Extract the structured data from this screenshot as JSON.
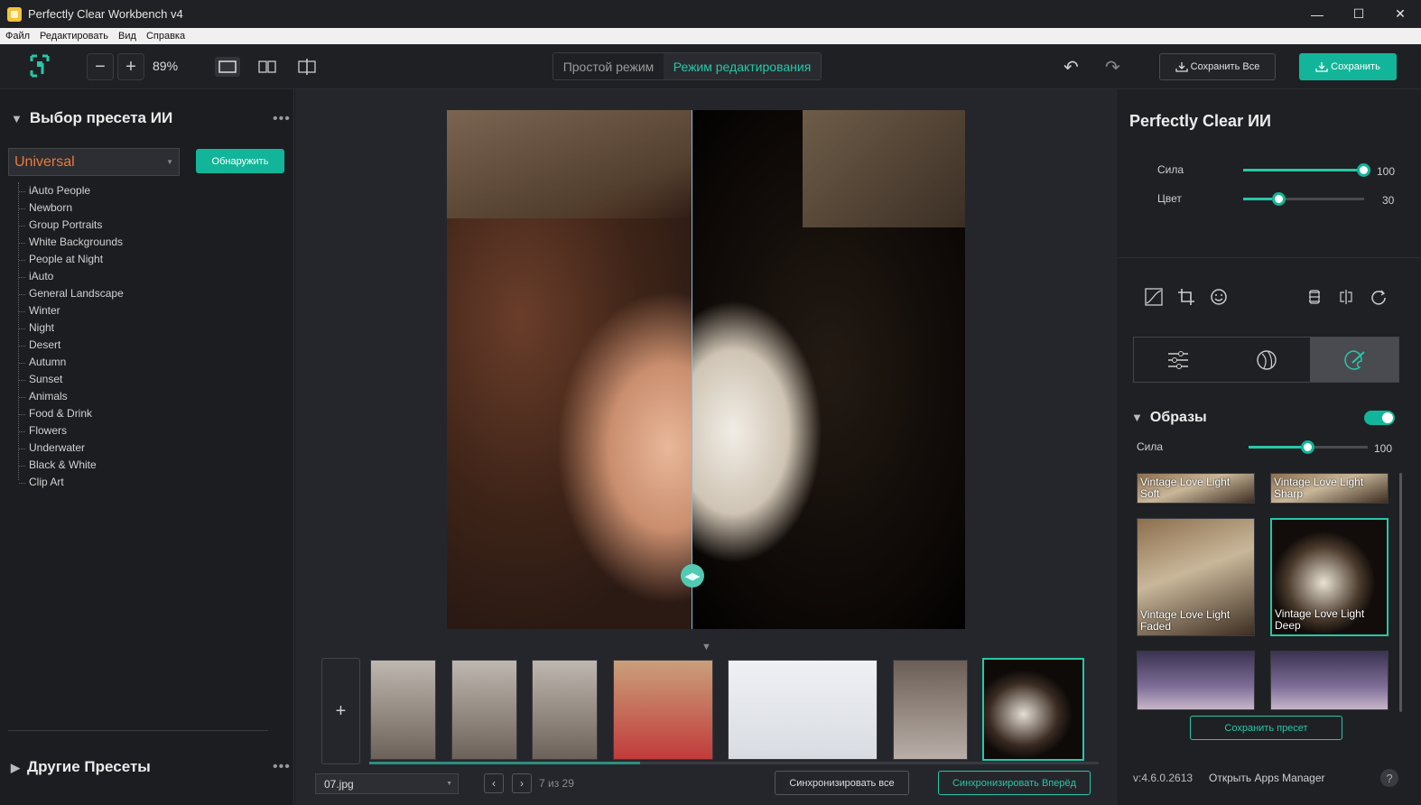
{
  "window": {
    "title": "Perfectly Clear Workbench v4",
    "minimize": "—",
    "maximize": "☐",
    "close": "✕"
  },
  "menu": [
    "Файл",
    "Редактировать",
    "Вид",
    "Справка"
  ],
  "toolbar": {
    "zoom_out": "−",
    "zoom_in": "+",
    "zoom": "89%",
    "mode_simple": "Простой режим",
    "mode_edit": "Режим редактирования",
    "undo": "↶",
    "redo": "↷",
    "save_all": "Сохранить Все",
    "save": "Сохранить"
  },
  "left": {
    "ai_title": "Выбор пресета ИИ",
    "dots": "•••",
    "preset_value": "Universal",
    "detect_label": "Обнаружить",
    "presets": [
      "iAuto People",
      "Newborn",
      "Group Portraits",
      "White Backgrounds",
      "People at Night",
      "iAuto",
      "General Landscape",
      "Winter",
      "Night",
      "Desert",
      "Autumn",
      "Sunset",
      "Animals",
      "Food & Drink",
      "Flowers",
      "Underwater",
      "Black & White",
      "Clip Art"
    ],
    "other_title": "Другие Пресеты"
  },
  "center": {
    "add": "+",
    "filename": "07.jpg",
    "prev": "‹",
    "next": "›",
    "count": "7 из 29",
    "sync_all": "Синхронизировать все",
    "sync_forward": "Синхронизировать Вперёд"
  },
  "right": {
    "title": "Perfectly Clear ИИ",
    "strength_label": "Сила",
    "strength_value": "100",
    "strength_level": 1.0,
    "color_label": "Цвет",
    "color_value": "30",
    "color_level": 0.3,
    "looks_title": "Образы",
    "looks_strength_label": "Сила",
    "looks_strength_value": "100",
    "looks_strength_level": 0.5,
    "looks": [
      {
        "label_1": "Vintage Love Light",
        "label_2": "Soft"
      },
      {
        "label_1": "Vintage Love Light",
        "label_2": "Sharp"
      },
      {
        "label_1": "Vintage Love Light",
        "label_2": "Faded"
      },
      {
        "label_1": "Vintage Love Light",
        "label_2": "Deep"
      }
    ],
    "save_preset": "Сохранить пресет",
    "version": "v:4.6.0.2613",
    "apps_manager": "Открыть Apps Manager",
    "help": "?"
  },
  "colors": {
    "accent": "#12b599",
    "accent_text": "#27c7a8",
    "preset_text": "#e87a3b"
  }
}
